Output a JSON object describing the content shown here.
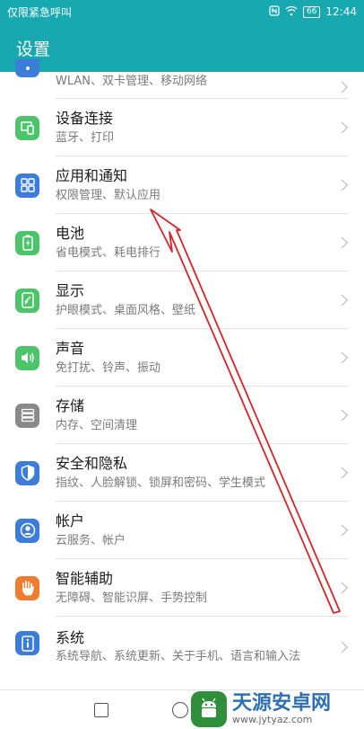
{
  "status_bar": {
    "carrier": "仅限紧急呼叫",
    "battery": "66",
    "time": "12:44"
  },
  "header": {
    "title": "设置"
  },
  "settings": [
    {
      "title": "",
      "subtitle": "WLAN、双卡管理、移动网络",
      "icon": "network-icon",
      "color": "#3b7dd8"
    },
    {
      "title": "设备连接",
      "subtitle": "蓝牙、打印",
      "icon": "device-connection-icon",
      "color": "#4cc46a"
    },
    {
      "title": "应用和通知",
      "subtitle": "权限管理、默认应用",
      "icon": "apps-grid-icon",
      "color": "#3b7dd8"
    },
    {
      "title": "电池",
      "subtitle": "省电模式、耗电排行",
      "icon": "battery-icon",
      "color": "#4cc46a"
    },
    {
      "title": "显示",
      "subtitle": "护眼模式、桌面风格、壁纸",
      "icon": "display-icon",
      "color": "#4cc46a"
    },
    {
      "title": "声音",
      "subtitle": "免打扰、铃声、振动",
      "icon": "speaker-icon",
      "color": "#4cc46a"
    },
    {
      "title": "存储",
      "subtitle": "内存、空间清理",
      "icon": "storage-icon",
      "color": "#8a8a8a"
    },
    {
      "title": "安全和隐私",
      "subtitle": "指纹、人脸解锁、锁屏和密码、学生模式",
      "icon": "shield-icon",
      "color": "#3b7dd8"
    },
    {
      "title": "帐户",
      "subtitle": "云服务、帐户",
      "icon": "account-icon",
      "color": "#3b7dd8"
    },
    {
      "title": "智能辅助",
      "subtitle": "无障碍、智能识屏、手势控制",
      "icon": "hand-icon",
      "color": "#f07d2f"
    },
    {
      "title": "系统",
      "subtitle": "系统导航、系统更新、关于手机、语言和输入法",
      "icon": "system-info-icon",
      "color": "#3b7dd8"
    }
  ],
  "watermark": {
    "name": "天源安卓网",
    "url": "www.jytyaz.com"
  },
  "colors": {
    "accent": "#17a8b0",
    "annotation_arrow": "#d8232a"
  }
}
